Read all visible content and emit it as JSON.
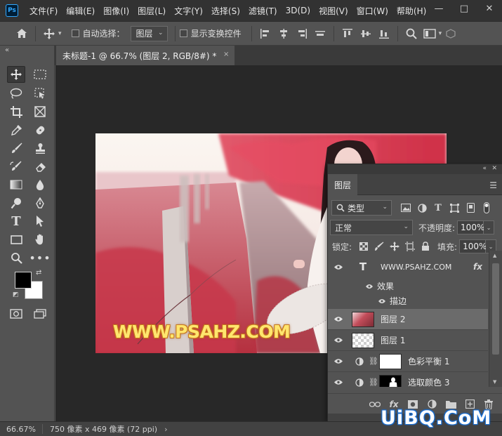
{
  "app": {
    "logo": "Ps"
  },
  "menu": [
    "文件(F)",
    "编辑(E)",
    "图像(I)",
    "图层(L)",
    "文字(Y)",
    "选择(S)",
    "滤镜(T)",
    "3D(D)",
    "视图(V)",
    "窗口(W)",
    "帮助(H)"
  ],
  "window_controls": {
    "minimize": "—",
    "maximize": "□",
    "close": "✕"
  },
  "options": {
    "auto_select_label": "自动选择：",
    "auto_select_value": "图层",
    "show_transform_label": "显示变换控件"
  },
  "document_tab": {
    "title": "未标题-1 @ 66.7% (图层 2, RGB/8#) *",
    "close": "×"
  },
  "canvas": {
    "watermark": "WWW.PSAHZ.COM",
    "colors": {
      "sky": "#fbf6f1",
      "foliage": "#d6344b",
      "road": "#a8858a",
      "post": "#d8cfcc"
    }
  },
  "colors": {
    "foreground": "#000000",
    "background": "#ffffff"
  },
  "status": {
    "zoom": "66.67%",
    "info": "750 像素 x 469 像素 (72 ppi)",
    "arrow": "›"
  },
  "layers_panel": {
    "tab": "图层",
    "filter_kind": "类型",
    "blend_mode": "正常",
    "opacity_label": "不透明度:",
    "opacity_value": "100%",
    "lock_label": "锁定:",
    "fill_label": "填充:",
    "fill_value": "100%",
    "text_layer": {
      "name": "WWW.PSAHZ.COM",
      "fx": "fx"
    },
    "effects_label": "效果",
    "stroke_label": "描边",
    "layers": [
      {
        "name": "图层 2",
        "selected": true
      },
      {
        "name": "图层 1",
        "selected": false
      },
      {
        "name": "色彩平衡 1",
        "selected": false
      },
      {
        "name": "选取颜色 3",
        "selected": false
      }
    ]
  },
  "site_watermark": "UiBQ.CoM"
}
